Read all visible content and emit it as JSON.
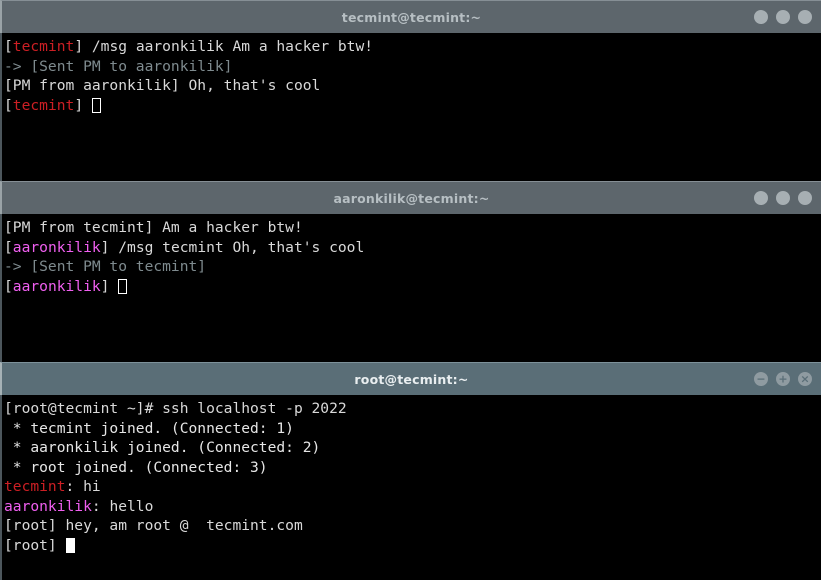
{
  "desktop": {
    "background_color": "#000000",
    "window_count": 3
  },
  "colors": {
    "titlebar_inactive": "#5d666c",
    "titlebar_active": "#5a6e77",
    "terminal_background": "#000000",
    "text_default": "#d8d8d8",
    "nick_tecmint": "#cc1f24",
    "nick_aaronkilik": "#f05ff0",
    "text_dim": "#7f8b8f"
  },
  "windows": [
    {
      "id": "win-1",
      "title": "tecmint@tecmint:~",
      "state": "inactive",
      "controls": [
        {
          "name": "minimize",
          "glyph": ""
        },
        {
          "name": "maximize",
          "glyph": ""
        },
        {
          "name": "close",
          "glyph": ""
        }
      ],
      "lines": [
        {
          "segments": [
            {
              "text": "[",
              "color": "white"
            },
            {
              "text": "tecmint",
              "color": "red"
            },
            {
              "text": "] /msg aaronkilik Am a hacker btw!",
              "color": "white"
            }
          ]
        },
        {
          "segments": [
            {
              "text": "-> [Sent PM to aaronkilik]",
              "color": "gray"
            }
          ]
        },
        {
          "segments": [
            {
              "text": "[PM from aaronkilik] Oh, that's cool",
              "color": "white"
            }
          ]
        },
        {
          "segments": [
            {
              "text": "[",
              "color": "white"
            },
            {
              "text": "tecmint",
              "color": "red"
            },
            {
              "text": "] ",
              "color": "white"
            }
          ],
          "cursor": "hollow"
        }
      ]
    },
    {
      "id": "win-2",
      "title": "aaronkilik@tecmint:~",
      "state": "inactive",
      "controls": [
        {
          "name": "minimize",
          "glyph": ""
        },
        {
          "name": "maximize",
          "glyph": ""
        },
        {
          "name": "close",
          "glyph": ""
        }
      ],
      "lines": [
        {
          "segments": [
            {
              "text": "[PM from tecmint] Am a hacker btw!",
              "color": "white"
            }
          ]
        },
        {
          "segments": [
            {
              "text": "[",
              "color": "white"
            },
            {
              "text": "aaronkilik",
              "color": "magenta"
            },
            {
              "text": "] /msg tecmint Oh, that's cool",
              "color": "white"
            }
          ]
        },
        {
          "segments": [
            {
              "text": "-> [Sent PM to tecmint]",
              "color": "gray"
            }
          ]
        },
        {
          "segments": [
            {
              "text": "[",
              "color": "white"
            },
            {
              "text": "aaronkilik",
              "color": "magenta"
            },
            {
              "text": "] ",
              "color": "white"
            }
          ],
          "cursor": "hollow"
        }
      ]
    },
    {
      "id": "win-3",
      "title": "root@tecmint:~",
      "state": "active",
      "controls": [
        {
          "name": "minimize",
          "glyph": "−"
        },
        {
          "name": "maximize",
          "glyph": "+"
        },
        {
          "name": "close",
          "glyph": "×"
        }
      ],
      "lines": [
        {
          "segments": [
            {
              "text": "[root@tecmint ~]# ssh localhost -p 2022",
              "color": "white"
            }
          ]
        },
        {
          "segments": [
            {
              "text": " * tecmint joined. (Connected: 1)",
              "color": "bright"
            }
          ]
        },
        {
          "segments": [
            {
              "text": " * aaronkilik joined. (Connected: 2)",
              "color": "bright"
            }
          ]
        },
        {
          "segments": [
            {
              "text": " * root joined. (Connected: 3)",
              "color": "bright"
            }
          ]
        },
        {
          "segments": [
            {
              "text": "tecmint",
              "color": "red"
            },
            {
              "text": ": hi",
              "color": "white"
            }
          ]
        },
        {
          "segments": [
            {
              "text": "aaronkilik",
              "color": "magenta"
            },
            {
              "text": ": hello",
              "color": "white"
            }
          ]
        },
        {
          "segments": [
            {
              "text": "[root] hey, am root @  tecmint.com",
              "color": "white"
            }
          ]
        },
        {
          "segments": [
            {
              "text": "[root] ",
              "color": "white"
            }
          ],
          "cursor": "solid"
        }
      ]
    }
  ]
}
